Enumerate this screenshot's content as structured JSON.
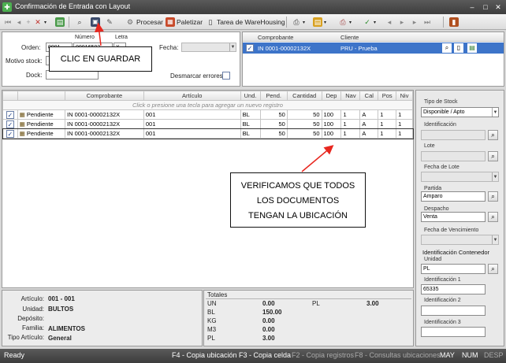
{
  "window": {
    "title": "Confirmación de Entrada con Layout",
    "minimize": "–",
    "maximize": "□",
    "close": "✕"
  },
  "toolbar": {
    "procesar": "Procesar",
    "paletizar": "Paletizar",
    "tarea": "Tarea de WareHousing"
  },
  "header_form": {
    "numero_label": "Número",
    "letra_label": "Letra",
    "orden_label": "Orden:",
    "orden_value": "0001",
    "numero_value": "00016503",
    "letra_value": "X",
    "fecha_label": "Fecha:",
    "motivo_label": "Motivo stock:",
    "dock_label": "Dock:",
    "desmarcar_label": "Desmarcar errores"
  },
  "doc_grid": {
    "headers": [
      "Comprobante",
      "Cliente"
    ],
    "rows": [
      {
        "comprobante": "IN 0001-00002132X",
        "cliente": "PRU - Prueba"
      }
    ]
  },
  "callouts": {
    "guardar": "CLIC EN GUARDAR",
    "verificamos_line1": "VERIFICAMOS QUE TODOS",
    "verificamos_line2": "LOS DOCUMENTOS",
    "verificamos_line3": "TENGAN LA UBICACIÓN"
  },
  "main_grid": {
    "headers": [
      "Comprobante",
      "Artículo",
      "Und.",
      "Pend.",
      "Cantidad",
      "Dep",
      "Nav",
      "Cal",
      "Pos",
      "Niv"
    ],
    "hint": "Click o presione una tecla para agregar un nuevo registro",
    "rows": [
      {
        "estado": "Pendiente",
        "comprobante": "IN 0001-00002132X",
        "articulo": "001",
        "und": "BL",
        "pend": "50",
        "cantidad": "50",
        "dep": "100",
        "nav": "1",
        "cal": "A",
        "pos": "1",
        "niv": "1"
      },
      {
        "estado": "Pendiente",
        "comprobante": "IN 0001-00002132X",
        "articulo": "001",
        "und": "BL",
        "pend": "50",
        "cantidad": "50",
        "dep": "100",
        "nav": "1",
        "cal": "A",
        "pos": "1",
        "niv": "1"
      },
      {
        "estado": "Pendiente",
        "comprobante": "IN 0001-00002132X",
        "articulo": "001",
        "und": "BL",
        "pend": "50",
        "cantidad": "50",
        "dep": "100",
        "nav": "1",
        "cal": "A",
        "pos": "1",
        "niv": "1"
      }
    ]
  },
  "side_panel": {
    "tipo_stock_label": "Tipo de Stock",
    "tipo_stock_value": "Disponible / Apto",
    "identificacion_label": "Identificación",
    "lote_label": "Lote",
    "fecha_lote_label": "Fecha de Lote",
    "partida_label": "Partida",
    "partida_value": "Amparo",
    "despacho_label": "Despacho",
    "despacho_value": "Venta",
    "fecha_venc_label": "Fecha de Vencimiento",
    "ident_contenedor_label": "Identificación Contenedor",
    "unidad_label": "Unidad",
    "unidad_value": "PL",
    "ident1_label": "Identificación 1",
    "ident1_value": "65335",
    "ident2_label": "Identificación 2",
    "ident3_label": "Identificación 3"
  },
  "article_info": {
    "articulo_label": "Artículo:",
    "articulo_value": "001 - 001",
    "unidad_label": "Unidad:",
    "unidad_value": "BULTOS",
    "deposito_label": "Depósito:",
    "deposito_value": "",
    "familia_label": "Familia:",
    "familia_value": "ALIMENTOS",
    "tipo_label": "Tipo Artículo:",
    "tipo_value": "General"
  },
  "totales": {
    "title": "Totales",
    "rows": [
      {
        "label": "UN",
        "value": "0.00"
      },
      {
        "label": "BL",
        "value": "150.00"
      },
      {
        "label": "KG",
        "value": "0.00"
      },
      {
        "label": "M3",
        "value": "0.00"
      },
      {
        "label": "PL",
        "value": "3.00"
      }
    ],
    "pl_label": "PL",
    "pl_value": "3.00"
  },
  "statusbar": {
    "ready": "Ready",
    "f4": "F4 - Copia ubicación",
    "f3": "F3 - Copia celda",
    "f2": "F2 - Copia registros",
    "f8": "F8 - Consultas ubicaciones",
    "may": "MAY",
    "num": "NUM",
    "desp": "DESP"
  },
  "colors": {
    "accent": "#1e5bb8",
    "selected_row": "#3d74c9",
    "arrow": "#e8271f"
  }
}
